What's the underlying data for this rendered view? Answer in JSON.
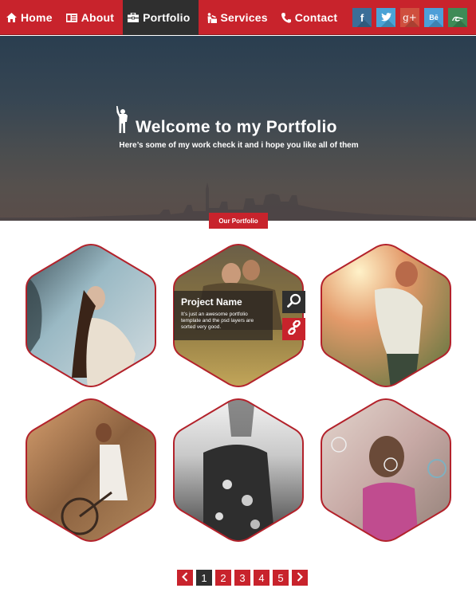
{
  "colors": {
    "brand_red": "#c8232c",
    "dark": "#2f2f2f",
    "hex_border": "#b3222b"
  },
  "nav": {
    "items": [
      {
        "label": "Home",
        "icon": "home-icon",
        "active": false
      },
      {
        "label": "About",
        "icon": "id-card-icon",
        "active": false
      },
      {
        "label": "Portfolio",
        "icon": "briefcase-icon",
        "active": true
      },
      {
        "label": "Services",
        "icon": "person-desk-icon",
        "active": false
      },
      {
        "label": "Contact",
        "icon": "phone-icon",
        "active": false
      }
    ],
    "social": [
      {
        "name": "facebook",
        "glyph": "f",
        "color": "#3b6e98"
      },
      {
        "name": "twitter",
        "glyph": "t",
        "color": "#4aa3d6"
      },
      {
        "name": "google-plus",
        "glyph": "g+",
        "color": "#cf4f3e"
      },
      {
        "name": "behance",
        "glyph": "Bē",
        "color": "#4d9fd8"
      },
      {
        "name": "deviantart",
        "glyph": "da",
        "color": "#3f8b57"
      }
    ]
  },
  "hero": {
    "title": "Welcome to my Portfolio",
    "subtitle": "Here’s some of my work check it and i hope you like all of them",
    "section_tag": "Our Portfolio"
  },
  "portfolio": {
    "items": [
      {
        "id": 1,
        "subject": "woman-in-forest",
        "palette": [
          "#c9dbe2",
          "#4c6570",
          "#8b6a50"
        ]
      },
      {
        "id": 2,
        "subject": "couple-in-field",
        "palette": [
          "#a48a5e",
          "#6a5a36",
          "#c9b06a"
        ],
        "hovered": true
      },
      {
        "id": 3,
        "subject": "couple-embracing-sunset",
        "palette": [
          "#e7b37a",
          "#c36a4f",
          "#7d8a4e"
        ]
      },
      {
        "id": 4,
        "subject": "couple-with-bicycle",
        "palette": [
          "#c99466",
          "#7f5a3c",
          "#d9c2a3"
        ]
      },
      {
        "id": 5,
        "subject": "woman-floral-dress",
        "palette": [
          "#efefef",
          "#8a8a8a",
          "#2a2a2a"
        ]
      },
      {
        "id": 6,
        "subject": "girl-blowing-bubbles",
        "palette": [
          "#d9c4be",
          "#c04c8f",
          "#8a7a6f"
        ]
      }
    ],
    "hover_card": {
      "title": "Project Name",
      "description": "It’s just an awesome portfolio template and the psd layers are sorted very good.",
      "actions": [
        "search-icon",
        "link-icon"
      ]
    }
  },
  "pagination": {
    "prev": "‹",
    "next": "›",
    "pages": [
      "1",
      "2",
      "3",
      "4",
      "5"
    ],
    "current": "1"
  }
}
